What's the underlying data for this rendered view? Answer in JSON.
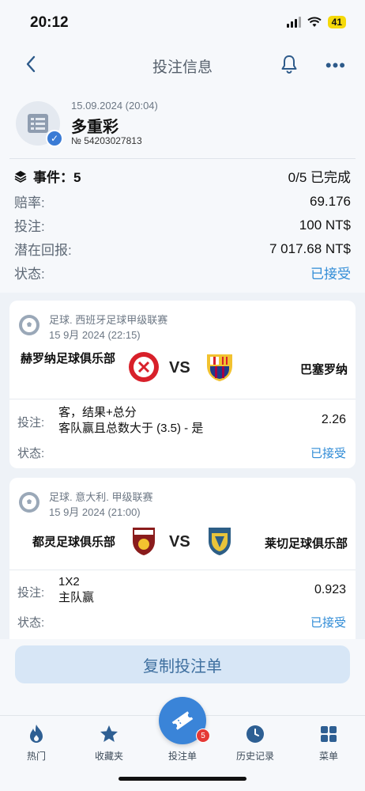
{
  "status_bar": {
    "time": "20:12",
    "battery": "41"
  },
  "header": {
    "title": "投注信息"
  },
  "bet": {
    "date": "15.09.2024 (20:04)",
    "type": "多重彩",
    "number": "№ 54203027813",
    "events_label": "事件：5",
    "events_value": "0/5 已完成",
    "odds_label": "赔率:",
    "odds_value": "69.176",
    "stake_label": "投注:",
    "stake_value": "100 NT$",
    "potential_label": "潜在回报:",
    "potential_value": "7 017.68 NT$",
    "status_label": "状态:",
    "status_value": "已接受"
  },
  "matches": [
    {
      "league": "足球. 西班牙足球甲级联赛",
      "date": "15 9月 2024 (22:15)",
      "home": "赫罗纳足球俱乐部",
      "vs": "VS",
      "away": "巴塞罗纳",
      "bet_label": "投注:",
      "selection_1": "客，结果+总分",
      "selection_2": "客队赢且总数大于 (3.5) - 是",
      "odds": "2.26",
      "status_label": "状态:",
      "status": "已接受"
    },
    {
      "league": "足球. 意大利. 甲级联赛",
      "date": "15 9月 2024 (21:00)",
      "home": "都灵足球俱乐部",
      "vs": "VS",
      "away": "莱切足球俱乐部",
      "bet_label": "投注:",
      "selection_1": "1X2",
      "selection_2": "主队赢",
      "odds": "0.923",
      "status_label": "状态:",
      "status": "已接受"
    }
  ],
  "copy_button": "复制投注单",
  "tabs": [
    {
      "label": "热门",
      "icon": "fire-icon"
    },
    {
      "label": "收藏夹",
      "icon": "star-icon"
    },
    {
      "label": "投注单",
      "icon": "ticket-icon",
      "badge": "5"
    },
    {
      "label": "历史记录",
      "icon": "clock-icon"
    },
    {
      "label": "菜单",
      "icon": "grid-icon"
    }
  ],
  "colors": {
    "accent": "#3a84d8",
    "accepted": "#2f8bd6"
  }
}
